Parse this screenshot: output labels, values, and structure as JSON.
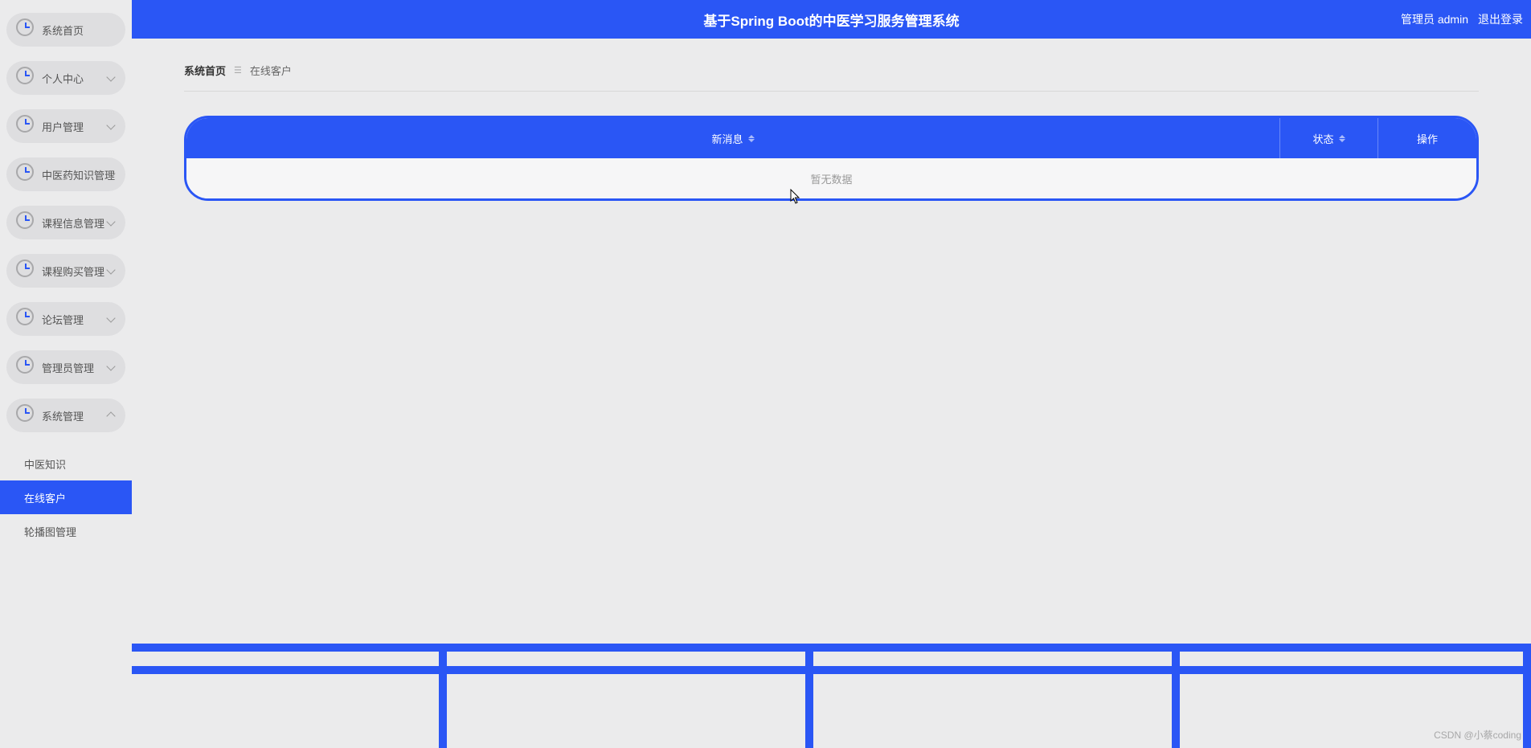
{
  "header": {
    "title": "基于Spring Boot的中医学习服务管理系统",
    "admin_label": "管理员 admin",
    "logout_label": "退出登录"
  },
  "sidebar": {
    "items": [
      {
        "label": "系统首页",
        "has_chevron": false
      },
      {
        "label": "个人中心",
        "has_chevron": true,
        "expanded": false
      },
      {
        "label": "用户管理",
        "has_chevron": true,
        "expanded": false
      },
      {
        "label": "中医药知识管理",
        "has_chevron": true,
        "expanded": false
      },
      {
        "label": "课程信息管理",
        "has_chevron": true,
        "expanded": false
      },
      {
        "label": "课程购买管理",
        "has_chevron": true,
        "expanded": false
      },
      {
        "label": "论坛管理",
        "has_chevron": true,
        "expanded": false
      },
      {
        "label": "管理员管理",
        "has_chevron": true,
        "expanded": false
      },
      {
        "label": "系统管理",
        "has_chevron": true,
        "expanded": true
      }
    ],
    "sub_items": [
      {
        "label": "中医知识",
        "active": false
      },
      {
        "label": "在线客户",
        "active": true
      },
      {
        "label": "轮播图管理",
        "active": false
      }
    ]
  },
  "breadcrumb": {
    "home": "系统首页",
    "separator": "☰",
    "current": "在线客户"
  },
  "table": {
    "headers": {
      "message": "新消息",
      "status": "状态",
      "action": "操作"
    },
    "empty_text": "暂无数据"
  },
  "watermark": "CSDN @小蔡coding"
}
